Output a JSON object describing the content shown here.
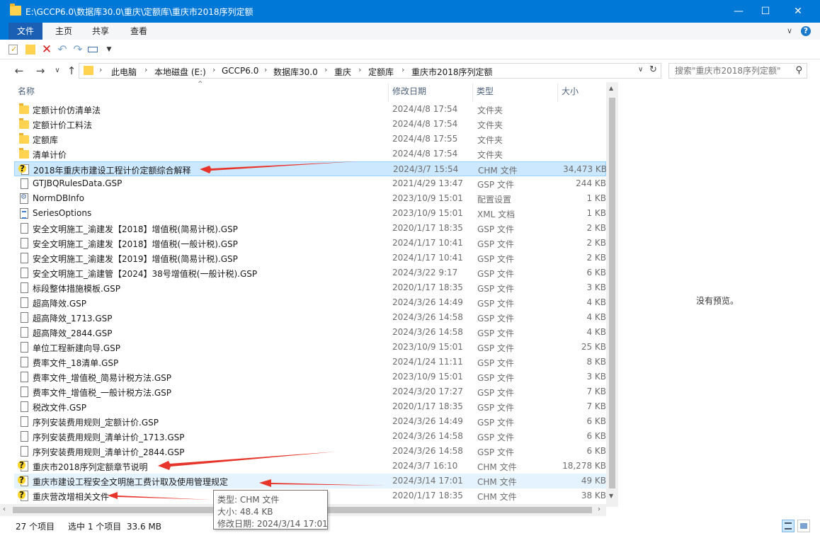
{
  "window": {
    "title": "E:\\GCCP6.0\\数据库30.0\\重庆\\定额库\\重庆市2018序列定额",
    "minimize_glyph": "—",
    "maximize_glyph": "☐",
    "close_glyph": "✕"
  },
  "ribbon": {
    "tabs": [
      "文件",
      "主页",
      "共享",
      "查看"
    ],
    "collapse_glyph": "∨",
    "help_glyph": "?"
  },
  "quick_access": {
    "icons": [
      "properties-icon",
      "new-folder-icon",
      "delete-icon",
      "undo-icon",
      "redo-icon",
      "rename-icon",
      "customize-dropdown-icon"
    ]
  },
  "nav": {
    "back_glyph": "←",
    "forward_glyph": "→",
    "recent_glyph": "∨",
    "up_glyph": "↑"
  },
  "address": {
    "crumbs": [
      "此电脑",
      "本地磁盘 (E:)",
      "GCCP6.0",
      "数据库30.0",
      "重庆",
      "定额库",
      "重庆市2018序列定额"
    ],
    "dropdown_glyph": "∨",
    "refresh_glyph": "↻"
  },
  "search": {
    "placeholder": "搜索\"重庆市2018序列定额\"",
    "icon_glyph": "⚲"
  },
  "columns": {
    "name": "名称",
    "date": "修改日期",
    "type": "类型",
    "size": "大小"
  },
  "files": [
    {
      "name": "定额计价仿清单法",
      "date": "2024/4/8 17:54",
      "type": "文件夹",
      "size": "",
      "icon": "folder"
    },
    {
      "name": "定额计价工料法",
      "date": "2024/4/8 17:54",
      "type": "文件夹",
      "size": "",
      "icon": "folder"
    },
    {
      "name": "定额库",
      "date": "2024/4/8 17:55",
      "type": "文件夹",
      "size": "",
      "icon": "folder"
    },
    {
      "name": "清单计价",
      "date": "2024/4/8 17:54",
      "type": "文件夹",
      "size": "",
      "icon": "folder"
    },
    {
      "name": "2018年重庆市建设工程计价定额综合解释",
      "date": "2024/3/7 15:54",
      "type": "CHM 文件",
      "size": "34,473 KB",
      "icon": "chm"
    },
    {
      "name": "GTJBQRulesData.GSP",
      "date": "2021/4/29 13:47",
      "type": "GSP 文件",
      "size": "244 KB",
      "icon": "file"
    },
    {
      "name": "NormDBInfo",
      "date": "2023/10/9 15:01",
      "type": "配置设置",
      "size": "1 KB",
      "icon": "cfg"
    },
    {
      "name": "SeriesOptions",
      "date": "2023/10/9 15:01",
      "type": "XML 文档",
      "size": "1 KB",
      "icon": "xml"
    },
    {
      "name": "安全文明施工_渝建发【2018】增值税(简易计税).GSP",
      "date": "2020/1/17 18:35",
      "type": "GSP 文件",
      "size": "2 KB",
      "icon": "file"
    },
    {
      "name": "安全文明施工_渝建发【2018】增值税(一般计税).GSP",
      "date": "2024/1/17 10:41",
      "type": "GSP 文件",
      "size": "2 KB",
      "icon": "file"
    },
    {
      "name": "安全文明施工_渝建发【2019】增值税(简易计税).GSP",
      "date": "2024/1/17 10:41",
      "type": "GSP 文件",
      "size": "2 KB",
      "icon": "file"
    },
    {
      "name": "安全文明施工_渝建管【2024】38号增值税(一般计税).GSP",
      "date": "2024/3/22 9:17",
      "type": "GSP 文件",
      "size": "6 KB",
      "icon": "file"
    },
    {
      "name": "标段整体措施模板.GSP",
      "date": "2020/1/17 18:35",
      "type": "GSP 文件",
      "size": "3 KB",
      "icon": "file"
    },
    {
      "name": "超高降效.GSP",
      "date": "2024/3/26 14:49",
      "type": "GSP 文件",
      "size": "4 KB",
      "icon": "file"
    },
    {
      "name": "超高降效_1713.GSP",
      "date": "2024/3/26 14:58",
      "type": "GSP 文件",
      "size": "4 KB",
      "icon": "file"
    },
    {
      "name": "超高降效_2844.GSP",
      "date": "2024/3/26 14:58",
      "type": "GSP 文件",
      "size": "4 KB",
      "icon": "file"
    },
    {
      "name": "单位工程新建向导.GSP",
      "date": "2023/10/9 15:01",
      "type": "GSP 文件",
      "size": "25 KB",
      "icon": "file"
    },
    {
      "name": "费率文件_18清单.GSP",
      "date": "2024/1/24 11:11",
      "type": "GSP 文件",
      "size": "8 KB",
      "icon": "file"
    },
    {
      "name": "费率文件_增值税_简易计税方法.GSP",
      "date": "2023/10/9 15:01",
      "type": "GSP 文件",
      "size": "3 KB",
      "icon": "file"
    },
    {
      "name": "费率文件_增值税_一般计税方法.GSP",
      "date": "2024/3/20 17:27",
      "type": "GSP 文件",
      "size": "7 KB",
      "icon": "file"
    },
    {
      "name": "税改文件.GSP",
      "date": "2020/1/17 18:35",
      "type": "GSP 文件",
      "size": "7 KB",
      "icon": "file"
    },
    {
      "name": "序列安装费用规则_定额计价.GSP",
      "date": "2024/3/26 14:49",
      "type": "GSP 文件",
      "size": "6 KB",
      "icon": "file"
    },
    {
      "name": "序列安装费用规则_清单计价_1713.GSP",
      "date": "2024/3/26 14:58",
      "type": "GSP 文件",
      "size": "6 KB",
      "icon": "file"
    },
    {
      "name": "序列安装费用规则_清单计价_2844.GSP",
      "date": "2024/3/26 14:58",
      "type": "GSP 文件",
      "size": "6 KB",
      "icon": "file"
    },
    {
      "name": "重庆市2018序列定额章节说明",
      "date": "2024/3/7 16:10",
      "type": "CHM 文件",
      "size": "18,278 KB",
      "icon": "chm"
    },
    {
      "name": "重庆市建设工程安全文明施工费计取及使用管理规定",
      "date": "2024/3/14 17:01",
      "type": "CHM 文件",
      "size": "49 KB",
      "icon": "chm"
    },
    {
      "name": "重庆营改增相关文件",
      "date": "2020/1/17 18:35",
      "type": "CHM 文件",
      "size": "38 KB",
      "icon": "chm"
    }
  ],
  "selected_index": 4,
  "hover_index": 25,
  "preview": {
    "message": "没有预览。"
  },
  "tooltip": {
    "type_line": "类型: CHM 文件",
    "size_line": "大小: 48.4 KB",
    "date_line": "修改日期: 2024/3/14 17:01"
  },
  "status": {
    "count": "27 个项目",
    "selection": "选中 1 个项目  33.6 MB"
  },
  "colors": {
    "accent": "#0078d7",
    "annotation_arrow": "#e8352b"
  }
}
